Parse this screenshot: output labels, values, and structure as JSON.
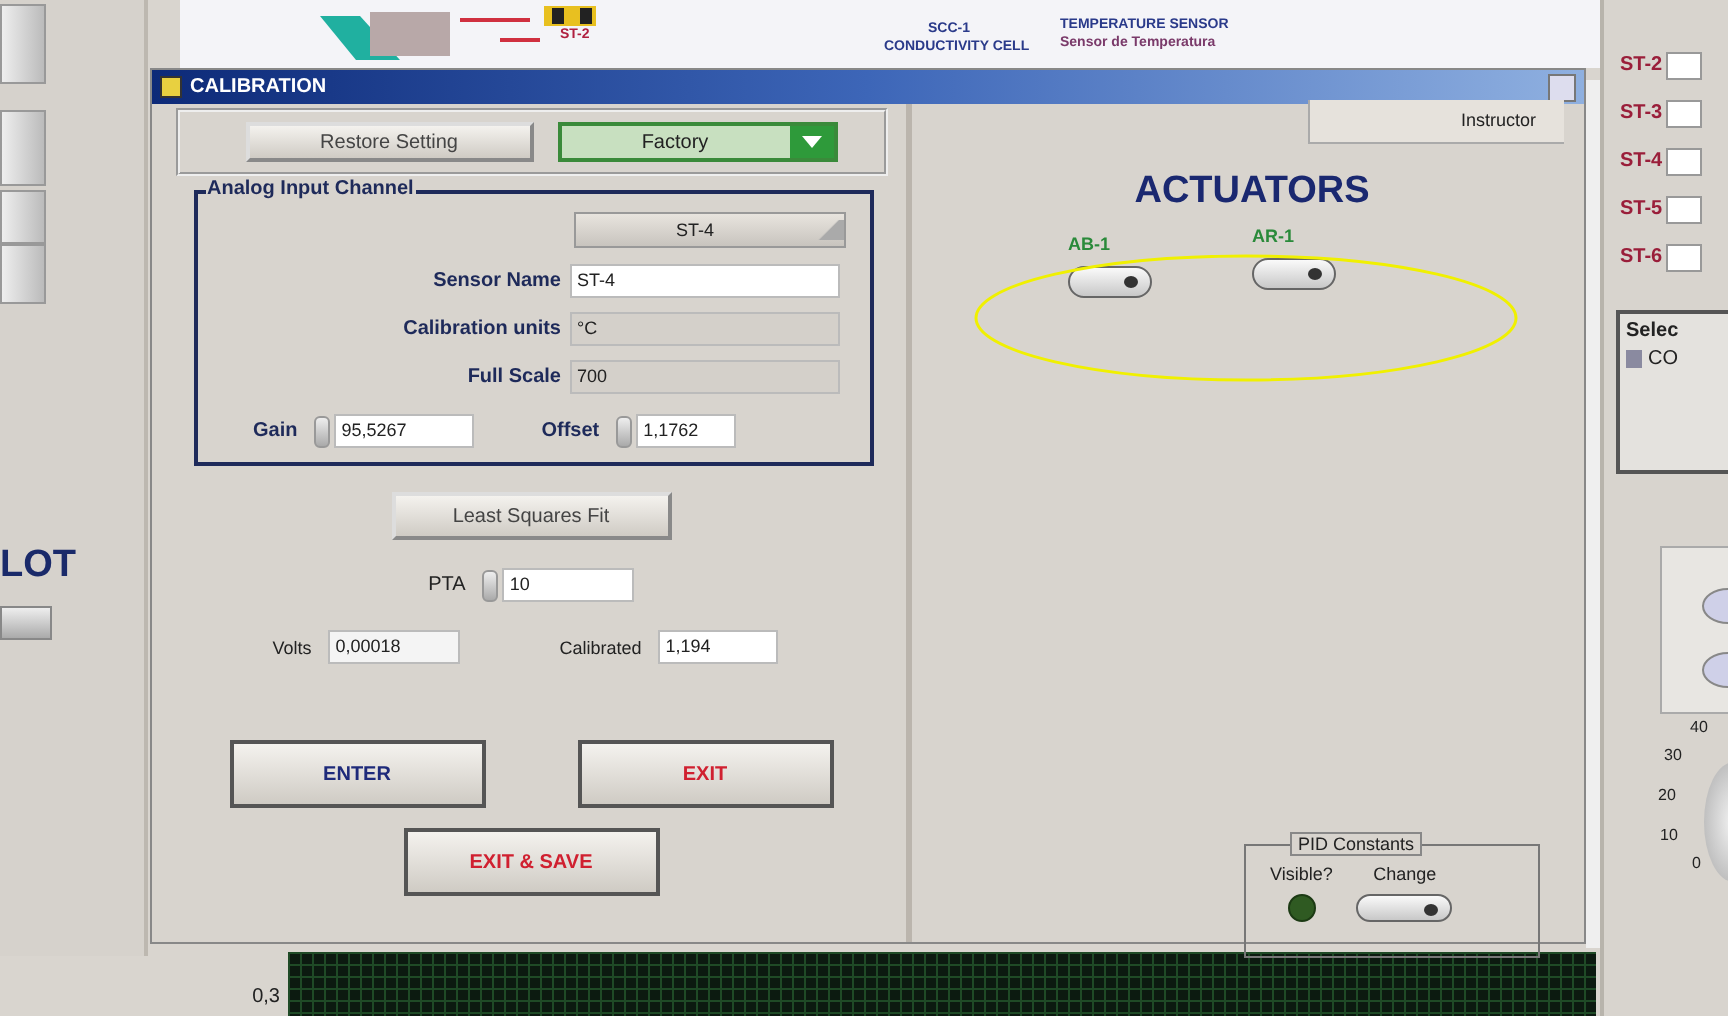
{
  "background": {
    "banner_labels": [
      {
        "text": "ST-2"
      },
      {
        "text": "SCC-1"
      },
      {
        "text": "CONDUCTIVITY CELL"
      },
      {
        "text": "TEMPERATURE SENSOR"
      },
      {
        "text": "Sensor de Temperatura"
      }
    ],
    "plot_title": "LOT",
    "sensors": [
      {
        "label": "ST-2"
      },
      {
        "label": "ST-3"
      },
      {
        "label": "ST-4"
      },
      {
        "label": "ST-5"
      },
      {
        "label": "ST-6"
      }
    ],
    "select_panel": {
      "title": "Selec",
      "item": "CO"
    },
    "dial_ticks": [
      "40",
      "30",
      "20",
      "10",
      "0"
    ],
    "chart_label": "0,3"
  },
  "window": {
    "title": "CALIBRATION"
  },
  "calibration": {
    "restore_button": "Restore Setting",
    "mode_dropdown": "Factory",
    "channel_group": {
      "title": "Analog Input Channel",
      "channel": "ST-4",
      "fields": [
        {
          "label": "Sensor Name",
          "value": "ST-4",
          "editable": true
        },
        {
          "label": "Calibration units",
          "value": "°C",
          "editable": false
        },
        {
          "label": "Full Scale",
          "value": "700",
          "editable": false
        }
      ],
      "gain": {
        "label": "Gain",
        "value": "95,5267"
      },
      "offset": {
        "label": "Offset",
        "value": "1,1762"
      }
    },
    "fit_button": "Least Squares Fit",
    "pta": {
      "label": "PTA",
      "value": "10"
    },
    "volts": {
      "label": "Volts",
      "value": "0,00018"
    },
    "calibrated": {
      "label": "Calibrated",
      "value": "1,194"
    },
    "buttons": [
      {
        "label": "ENTER",
        "kind": "enter"
      },
      {
        "label": "EXIT",
        "kind": "exit"
      },
      {
        "label": "EXIT & SAVE",
        "kind": "exit"
      }
    ]
  },
  "actuators_panel": {
    "tab": "Instructor",
    "title": "ACTUATORS",
    "actuators": [
      {
        "label": "AB-1",
        "on": false
      },
      {
        "label": "AR-1",
        "on": false
      }
    ],
    "pid": {
      "title": "PID Constants",
      "visible_label": "Visible?",
      "visible_on": false,
      "change_label": "Change",
      "change_on": false
    }
  }
}
